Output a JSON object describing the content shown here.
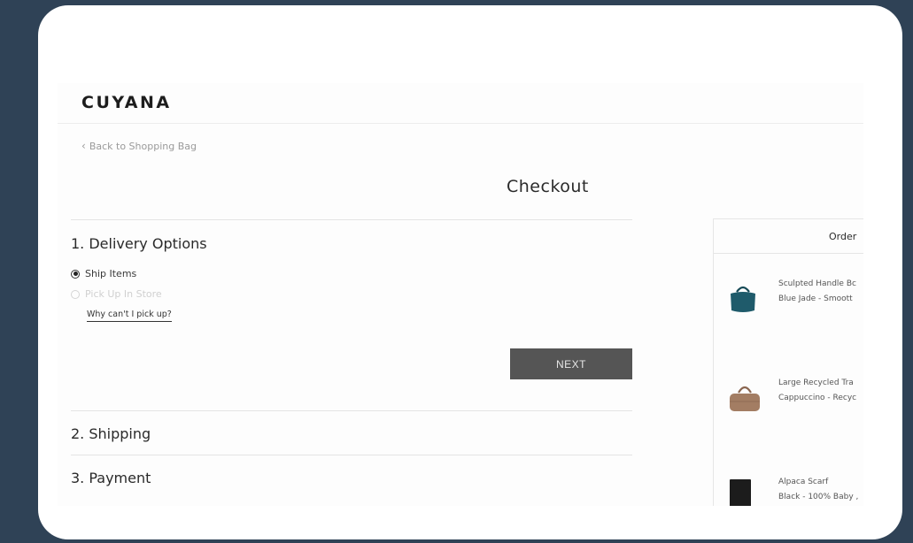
{
  "header": {
    "logo": "CUYANA"
  },
  "nav": {
    "back_label": "Back to Shopping Bag"
  },
  "page": {
    "title": "Checkout"
  },
  "steps": {
    "delivery": {
      "heading": "1. Delivery Options",
      "options": [
        {
          "label": "Ship Items",
          "checked": true,
          "disabled": false
        },
        {
          "label": "Pick Up In Store",
          "checked": false,
          "disabled": true
        }
      ],
      "why_link": "Why can't I pick up?",
      "next_label": "NEXT"
    },
    "shipping": {
      "heading": "2. Shipping"
    },
    "payment": {
      "heading": "3. Payment"
    }
  },
  "summary": {
    "heading": "Order",
    "items": [
      {
        "name": "Sculpted Handle Bc",
        "variant": "Blue Jade - Smoott",
        "color": "#1f5b6b",
        "icon": "handbag-icon"
      },
      {
        "name": "Large Recycled Tra",
        "variant": "Cappuccino - Recyc",
        "color": "#a37d63",
        "icon": "duffel-bag-icon"
      },
      {
        "name": "Alpaca Scarf",
        "variant": "Black - 100% Baby ,",
        "color": "#1c1c1c",
        "icon": "scarf-icon"
      }
    ]
  },
  "colors": {
    "background": "#2f4256",
    "button": "#555555"
  }
}
